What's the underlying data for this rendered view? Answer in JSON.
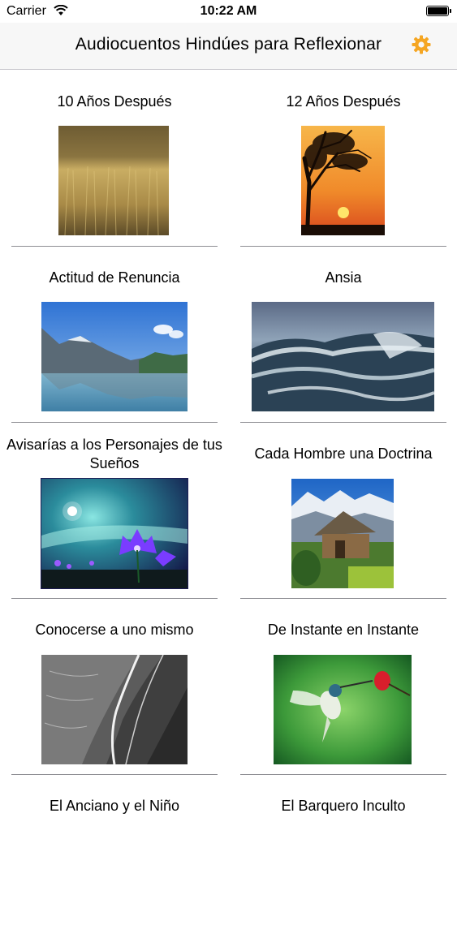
{
  "status": {
    "carrier": "Carrier",
    "time": "10:22 AM"
  },
  "header": {
    "title": "Audiocuentos Hindúes para Reflexionar",
    "settings_icon": "gear-icon",
    "accent": "#f5a623"
  },
  "stories": [
    {
      "title": "10 Años Después",
      "image": "wheat-field-image"
    },
    {
      "title": "12 Años Después",
      "image": "tree-sunset-image"
    },
    {
      "title": "Actitud de Renuncia",
      "image": "mountain-lake-image"
    },
    {
      "title": "Ansia",
      "image": "ocean-wave-image"
    },
    {
      "title": "Avisarías a los Personajes de tus Sueños",
      "image": "fantasy-night-flowers-image"
    },
    {
      "title": "Cada Hombre una Doctrina",
      "image": "mountain-hut-image"
    },
    {
      "title": "Conocerse a uno mismo",
      "image": "beach-shore-image"
    },
    {
      "title": "De Instante en Instante",
      "image": "hummingbird-image"
    },
    {
      "title": "El Anciano y el Niño",
      "image": ""
    },
    {
      "title": "El Barquero Inculto",
      "image": ""
    }
  ]
}
